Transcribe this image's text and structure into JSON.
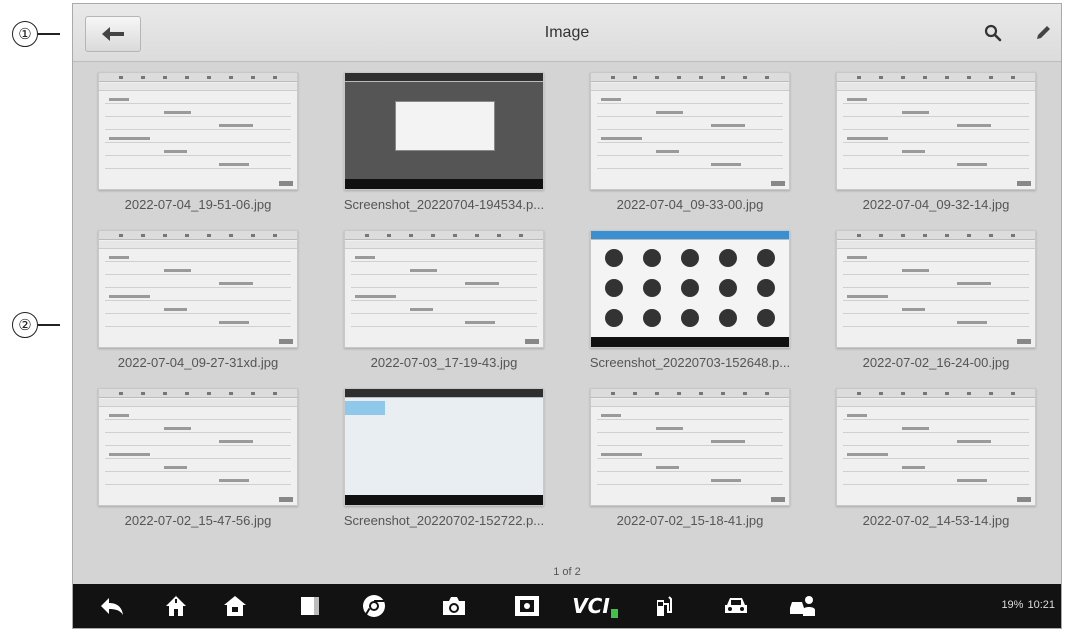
{
  "callouts": [
    "①",
    "②"
  ],
  "header": {
    "title": "Image",
    "back": "back-arrow-icon",
    "search": "search-icon",
    "edit": "pencil-icon"
  },
  "images": [
    {
      "filename": "2022-07-04_19-51-06.jpg"
    },
    {
      "filename": "Screenshot_20220704-194534.p..."
    },
    {
      "filename": "2022-07-04_09-33-00.jpg"
    },
    {
      "filename": "2022-07-04_09-32-14.jpg"
    },
    {
      "filename": "2022-07-04_09-27-31xd.jpg"
    },
    {
      "filename": "2022-07-03_17-19-43.jpg"
    },
    {
      "filename": "Screenshot_20220703-152648.p..."
    },
    {
      "filename": "2022-07-02_16-24-00.jpg"
    },
    {
      "filename": "2022-07-02_15-47-56.jpg"
    },
    {
      "filename": "Screenshot_20220702-152722.p..."
    },
    {
      "filename": "2022-07-02_15-18-41.jpg"
    },
    {
      "filename": "2022-07-02_14-53-14.jpg"
    }
  ],
  "pager": "1 of 2",
  "navbar": {
    "icons": [
      "back-icon",
      "home-icon",
      "house-icon",
      "recent-apps-icon",
      "chrome-icon",
      "camera-icon",
      "screen-capture-icon",
      "vci-icon",
      "fuel-pump-icon",
      "car-icon",
      "car-user-icon"
    ],
    "vci_label": "VCI"
  },
  "status": {
    "battery": "19%",
    "time": "10:21"
  },
  "colors": {
    "topbar": "#dcdcdc",
    "body": "#d4d4d4",
    "navbar": "#121212",
    "vci_accent": "#43c24a"
  }
}
